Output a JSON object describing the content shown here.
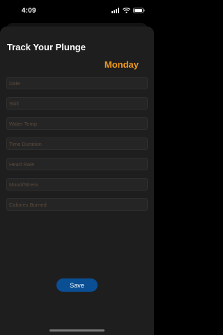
{
  "status_bar": {
    "time": "4:09",
    "icons": [
      "signal-icon",
      "wifi-icon",
      "battery-icon"
    ]
  },
  "sheet": {
    "title": "Track Your Plunge",
    "day": "Monday",
    "fields": [
      {
        "placeholder": "Date"
      },
      {
        "placeholder": "Skill"
      },
      {
        "placeholder": "Water Temp"
      },
      {
        "placeholder": "Time Duration"
      },
      {
        "placeholder": "Heart Rate"
      },
      {
        "placeholder": "Mood/Stress"
      },
      {
        "placeholder": "Calories Burned"
      }
    ],
    "save_label": "Save"
  },
  "colors": {
    "background": "#1e1e1f",
    "accent": "#f29a1d",
    "button": "#0a4f94",
    "placeholder": "#5a4a3a"
  }
}
